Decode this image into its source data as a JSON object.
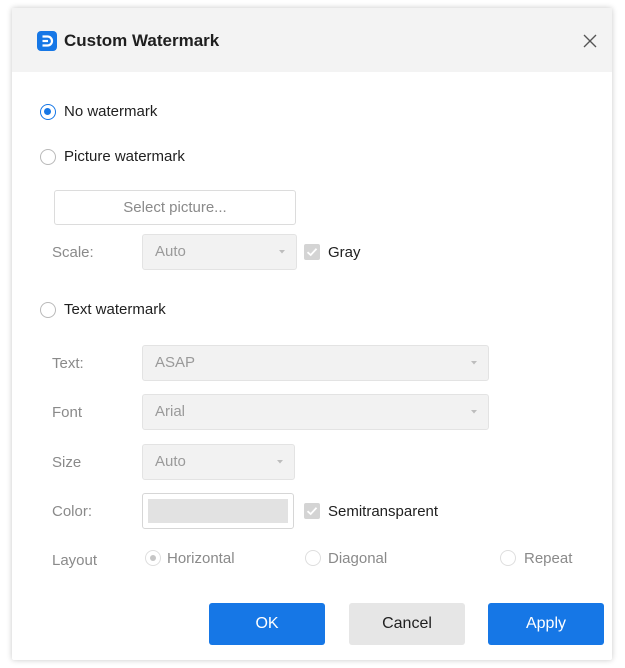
{
  "dialog": {
    "title": "Custom Watermark",
    "logo_icon": "app-logo-icon",
    "close_icon": "close-icon"
  },
  "options": {
    "no_watermark": {
      "label": "No watermark",
      "selected": true
    },
    "picture_watermark": {
      "label": "Picture watermark",
      "selected": false
    },
    "text_watermark": {
      "label": "Text watermark",
      "selected": false
    }
  },
  "picture": {
    "select_button": "Select picture...",
    "scale_label": "Scale:",
    "scale_value": "Auto",
    "gray_label": "Gray",
    "gray_checked": true
  },
  "text": {
    "text_label": "Text:",
    "text_value": "ASAP",
    "font_label": "Font",
    "font_value": "Arial",
    "size_label": "Size",
    "size_value": "Auto",
    "color_label": "Color:",
    "color_value": "#e2e2e2",
    "semitransparent_label": "Semitransparent",
    "semitransparent_checked": true,
    "layout_label": "Layout",
    "layout_options": [
      {
        "label": "Horizontal",
        "selected": true
      },
      {
        "label": "Diagonal",
        "selected": false
      },
      {
        "label": "Repeat",
        "selected": false
      }
    ]
  },
  "buttons": {
    "ok": "OK",
    "cancel": "Cancel",
    "apply": "Apply"
  },
  "colors": {
    "accent": "#1677e6",
    "disabled_text": "#8a8a8a"
  }
}
